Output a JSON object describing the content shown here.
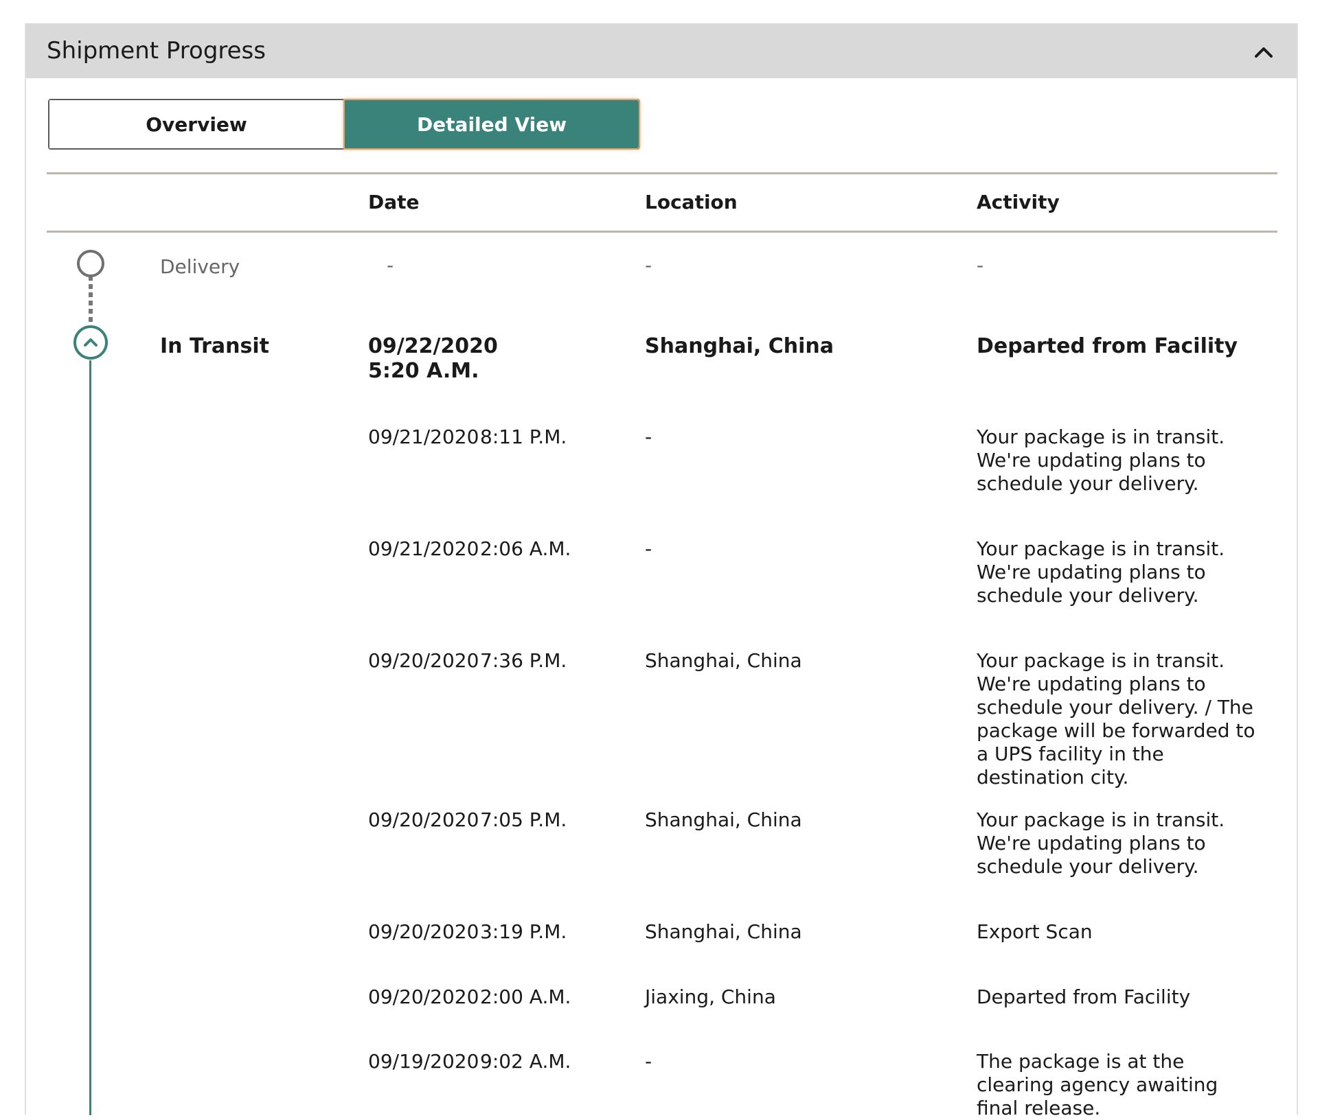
{
  "panel": {
    "title": "Shipment Progress",
    "collapse_icon": "chevron-up-icon"
  },
  "view_toggle": {
    "overview_label": "Overview",
    "detailed_label": "Detailed View",
    "selected": "Detailed View"
  },
  "columns": {
    "date": "Date",
    "location": "Location",
    "activity": "Activity"
  },
  "milestones": {
    "delivery": {
      "label": "Delivery",
      "date": "-",
      "location": "-",
      "activity": "-",
      "icon": "empty-circle-icon"
    },
    "in_transit": {
      "label": "In Transit",
      "date": "09/22/2020",
      "time": "5:20 A.M.",
      "location": "Shanghai, China",
      "activity": "Departed from Facility",
      "icon": "chevron-up-circle-icon"
    }
  },
  "events": [
    {
      "date": "09/21/2020",
      "time": "8:11 P.M.",
      "location": "-",
      "activity": "Your package is in transit. We're updating plans to schedule your delivery."
    },
    {
      "date": "09/21/2020",
      "time": "2:06 A.M.",
      "location": "-",
      "activity": "Your package is in transit. We're updating plans to schedule your delivery."
    },
    {
      "date": "09/20/2020",
      "time": "7:36 P.M.",
      "location": "Shanghai, China",
      "activity": "Your package is in transit. We're updating plans to schedule your delivery. / The package will be forwarded to a UPS facility in the destination city."
    },
    {
      "date": "09/20/2020",
      "time": "7:05 P.M.",
      "location": "Shanghai, China",
      "activity": "Your package is in transit. We're updating plans to schedule your delivery."
    },
    {
      "date": "09/20/2020",
      "time": "3:19 P.M.",
      "location": "Shanghai, China",
      "activity": "Export Scan"
    },
    {
      "date": "09/20/2020",
      "time": "2:00 A.M.",
      "location": "Jiaxing, China",
      "activity": "Departed from Facility"
    },
    {
      "date": "09/19/2020",
      "time": "9:02 A.M.",
      "location": "-",
      "activity": "The package is at the clearing agency awaiting final release."
    }
  ],
  "colors": {
    "accent": "#3a837b",
    "header_bg": "#d9d9d9",
    "rule": "#bfb6ab",
    "focus_ring": "#d9a46a"
  }
}
